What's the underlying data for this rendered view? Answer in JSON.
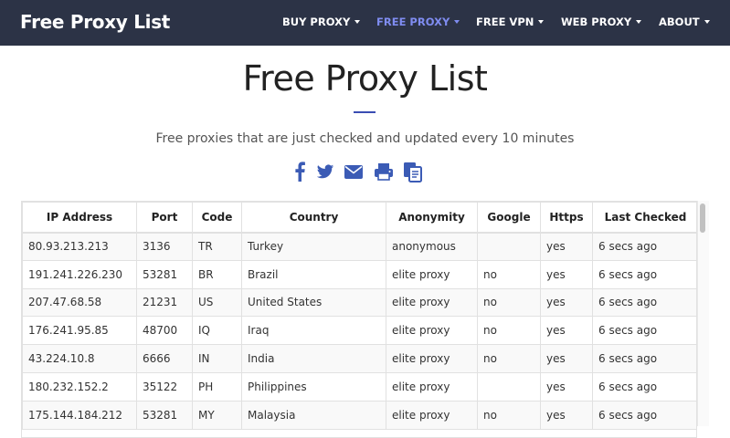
{
  "navbar": {
    "brand": "Free Proxy List",
    "items": [
      {
        "label": "BUY PROXY",
        "active": false
      },
      {
        "label": "FREE PROXY",
        "active": true
      },
      {
        "label": "FREE VPN",
        "active": false
      },
      {
        "label": "WEB PROXY",
        "active": false
      },
      {
        "label": "ABOUT",
        "active": false
      }
    ]
  },
  "page": {
    "title": "Free Proxy List",
    "subtitle": "Free proxies that are just checked and updated every 10 minutes"
  },
  "share": {
    "icons": [
      "facebook-icon",
      "twitter-icon",
      "email-icon",
      "print-icon",
      "copy-icon"
    ],
    "color": "#3b5bb5"
  },
  "table": {
    "headers": [
      "IP Address",
      "Port",
      "Code",
      "Country",
      "Anonymity",
      "Google",
      "Https",
      "Last Checked"
    ],
    "rows": [
      [
        "80.93.213.213",
        "3136",
        "TR",
        "Turkey",
        "anonymous",
        "",
        "yes",
        "6 secs ago"
      ],
      [
        "191.241.226.230",
        "53281",
        "BR",
        "Brazil",
        "elite proxy",
        "no",
        "yes",
        "6 secs ago"
      ],
      [
        "207.47.68.58",
        "21231",
        "US",
        "United States",
        "elite proxy",
        "no",
        "yes",
        "6 secs ago"
      ],
      [
        "176.241.95.85",
        "48700",
        "IQ",
        "Iraq",
        "elite proxy",
        "no",
        "yes",
        "6 secs ago"
      ],
      [
        "43.224.10.8",
        "6666",
        "IN",
        "India",
        "elite proxy",
        "no",
        "yes",
        "6 secs ago"
      ],
      [
        "180.232.152.2",
        "35122",
        "PH",
        "Philippines",
        "elite proxy",
        "",
        "yes",
        "6 secs ago"
      ],
      [
        "175.144.184.212",
        "53281",
        "MY",
        "Malaysia",
        "elite proxy",
        "no",
        "yes",
        "6 secs ago"
      ]
    ]
  },
  "colors": {
    "navbar_bg": "#2c3346",
    "nav_active": "#7f8cf0",
    "accent_rule": "#3a4db3"
  }
}
